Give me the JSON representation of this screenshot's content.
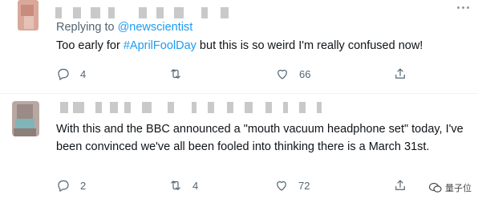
{
  "tweets": [
    {
      "replying_prefix": "Replying to",
      "replying_handle": "@newscientist",
      "text_before": "Too early for ",
      "hashtag": "#AprilFoolDay",
      "text_after": " but this is so weird I'm really confused now!",
      "actions": {
        "replies": "4",
        "retweets": "",
        "likes": "66"
      }
    },
    {
      "text": "With this and the BBC announced a \"mouth vacuum headphone set\" today, I've been convinced we've all been fooled into thinking there is a March 31st.",
      "actions": {
        "replies": "2",
        "retweets": "4",
        "likes": "72"
      }
    }
  ],
  "watermark": "量子位",
  "icons": [
    "more-icon",
    "reply-icon",
    "retweet-icon",
    "like-icon",
    "share-icon"
  ],
  "colors": {
    "link": "#1d9bf0",
    "muted": "#536471",
    "text": "#0f1419"
  }
}
